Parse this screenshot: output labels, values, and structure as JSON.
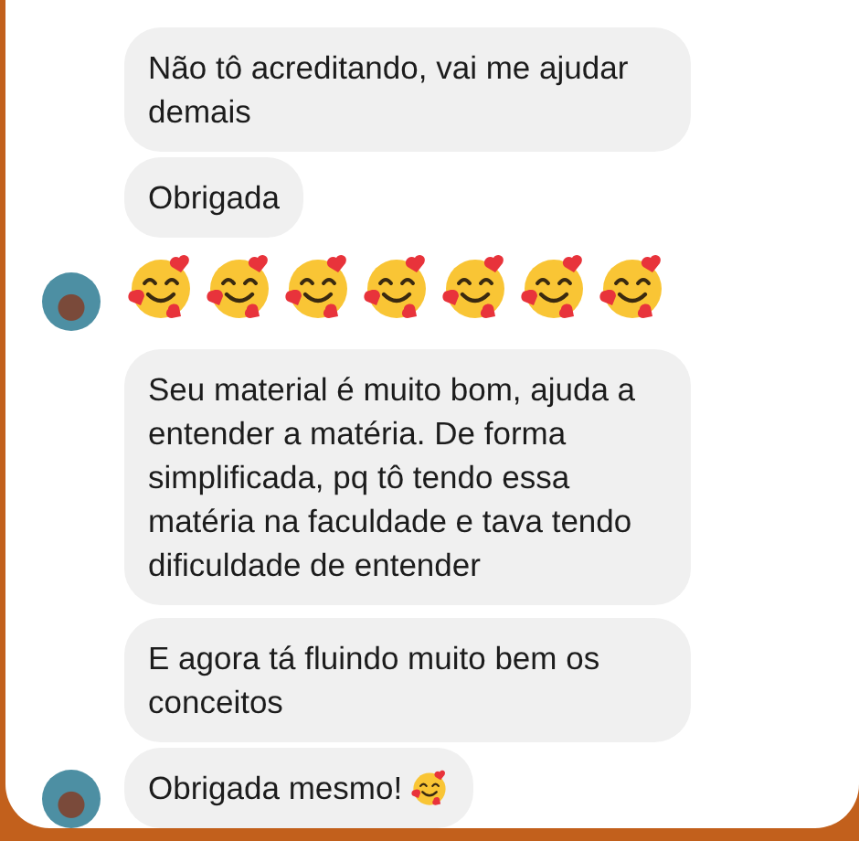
{
  "messages": [
    {
      "kind": "text",
      "text": "Não tô acreditando, vai me ajudar demais",
      "show_avatar": false
    },
    {
      "kind": "text",
      "text": "Obrigada",
      "show_avatar": false
    },
    {
      "kind": "emoji",
      "show_avatar": true,
      "emojis": [
        {
          "kind": "smiling-face-with-hearts"
        },
        {
          "kind": "smiling-face-with-hearts"
        },
        {
          "kind": "smiling-face-with-hearts"
        },
        {
          "kind": "smiling-face-with-hearts"
        },
        {
          "kind": "smiling-face-with-hearts"
        },
        {
          "kind": "smiling-face-with-hearts"
        },
        {
          "kind": "smiling-face-with-hearts"
        }
      ]
    },
    {
      "kind": "text",
      "text": "Seu material é muito bom, ajuda a entender a matéria. De forma simplificada, pq tô tendo essa matéria na faculdade e tava tendo dificuldade de entender",
      "show_avatar": false
    },
    {
      "kind": "text",
      "text": "E agora tá fluindo muito bem os conceitos",
      "show_avatar": false
    },
    {
      "kind": "text",
      "text": "Obrigada mesmo!",
      "show_avatar": true,
      "emojis": [
        {
          "kind": "smiling-face-with-hearts"
        }
      ]
    }
  ]
}
